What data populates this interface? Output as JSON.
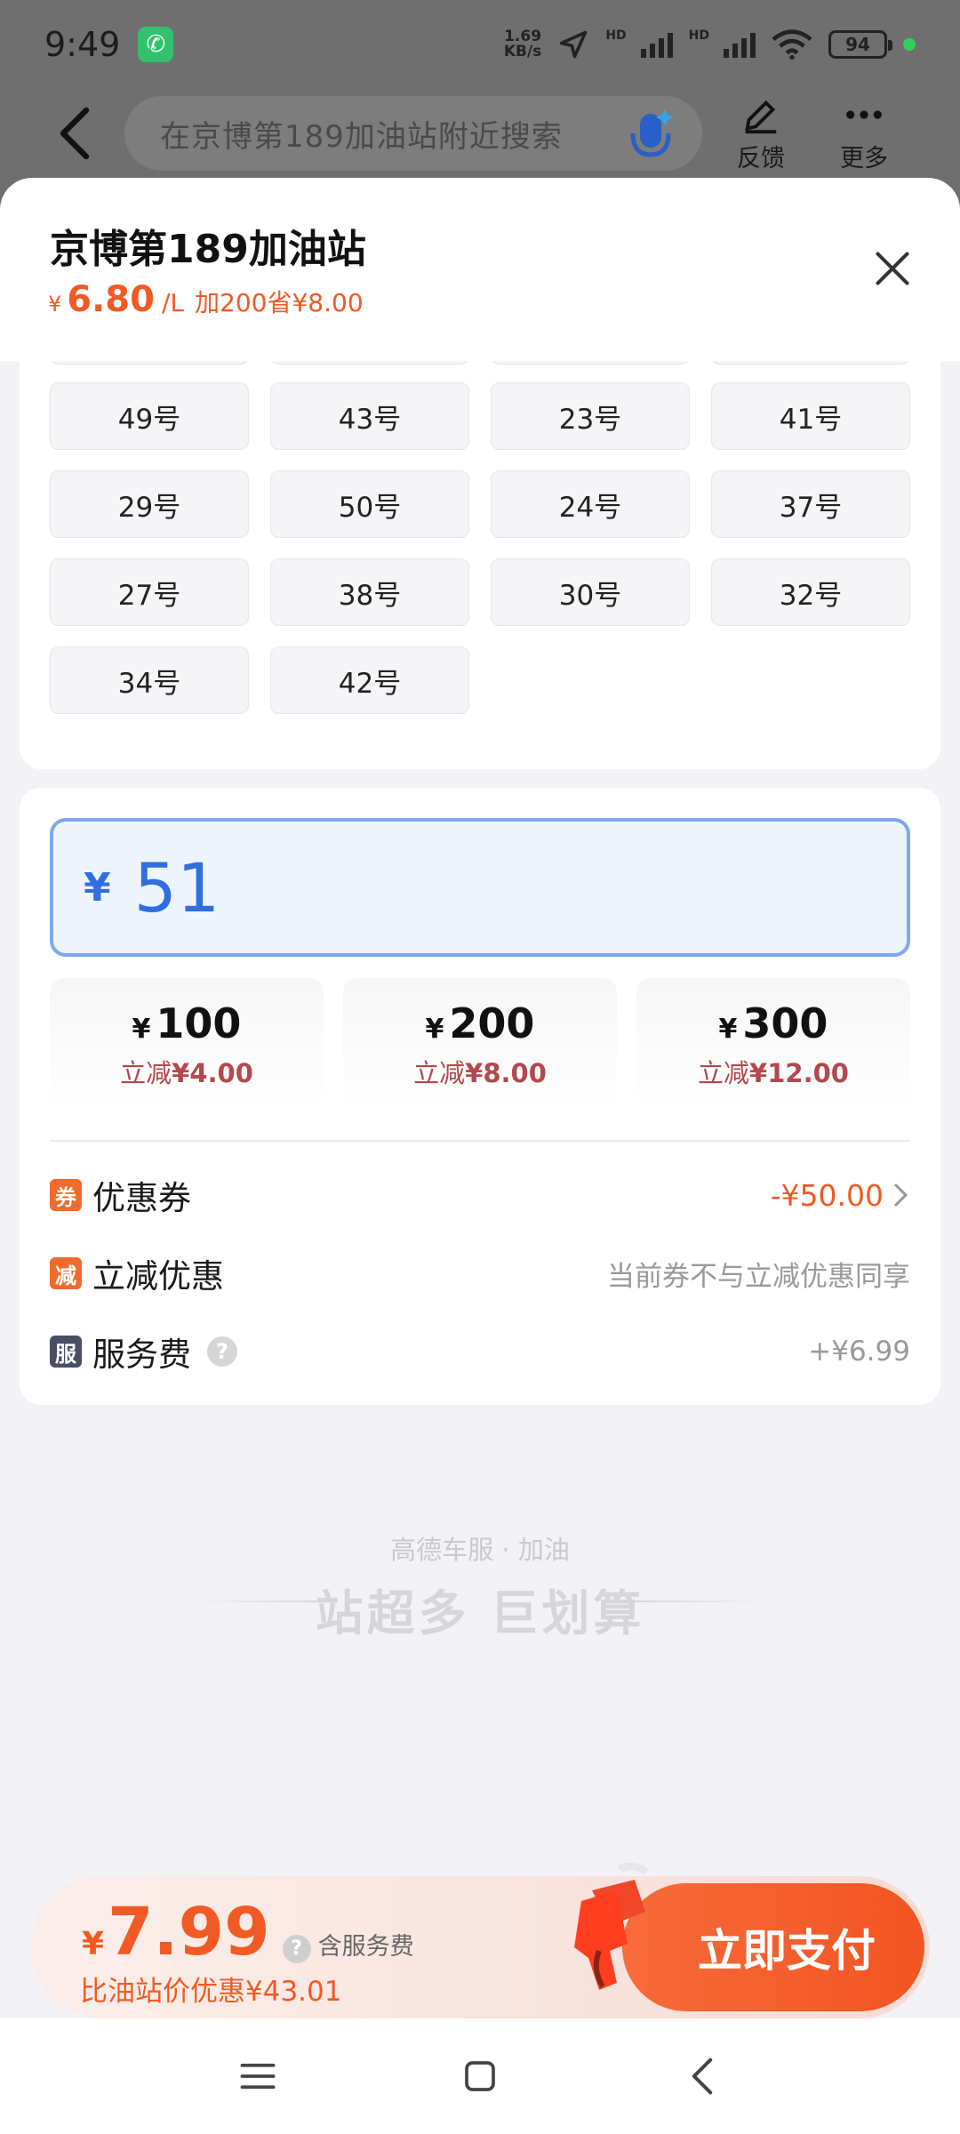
{
  "status_bar": {
    "time": "9:49",
    "net_speed_value": "1.69",
    "net_speed_unit": "KB/s",
    "battery": "94",
    "icons": [
      "phone-call-icon",
      "location-arrow-icon",
      "signal-icon",
      "wifi-icon",
      "battery-icon"
    ]
  },
  "nav": {
    "search_placeholder": "在京博第189加油站附近搜索",
    "feedback_label": "反馈",
    "more_label": "更多"
  },
  "station": {
    "name": "京博第189加油站",
    "yen": "¥",
    "price": "6.80",
    "unit": "/L",
    "promo": "加200省¥8.00"
  },
  "pumps": [
    "49号",
    "43号",
    "23号",
    "41号",
    "29号",
    "50号",
    "24号",
    "37号",
    "27号",
    "38号",
    "30号",
    "32号",
    "34号",
    "42号"
  ],
  "amount": {
    "yen": "¥",
    "value": "51"
  },
  "quick_amounts": [
    {
      "yen": "¥",
      "amount": "100",
      "save_prefix": "立减",
      "save_value": "¥4.00"
    },
    {
      "yen": "¥",
      "amount": "200",
      "save_prefix": "立减",
      "save_value": "¥8.00"
    },
    {
      "yen": "¥",
      "amount": "300",
      "save_prefix": "立减",
      "save_value": "¥12.00"
    }
  ],
  "rows": {
    "coupon": {
      "tag": "券",
      "title": "优惠券",
      "value": "-¥50.00",
      "tag_color": "#f06a2a"
    },
    "discount": {
      "tag": "减",
      "title": "立减优惠",
      "value": "当前券不与立减优惠同享",
      "tag_color": "#f06a2a"
    },
    "service": {
      "tag": "服",
      "title": "服务费",
      "help": "?",
      "value": "+¥6.99",
      "tag_color": "#4a4f63"
    }
  },
  "branding": {
    "sub": "高德车服 · 加油",
    "main": "站超多 巨划算"
  },
  "pay": {
    "yen": "¥",
    "total": "7.99",
    "help": "?",
    "includes": "含服务费",
    "savings": "比油站价优惠¥43.01",
    "button": "立即支付"
  },
  "colors": {
    "accent": "#f15a24",
    "input_border": "#7ea7ec",
    "input_text": "#2f6fe0"
  }
}
